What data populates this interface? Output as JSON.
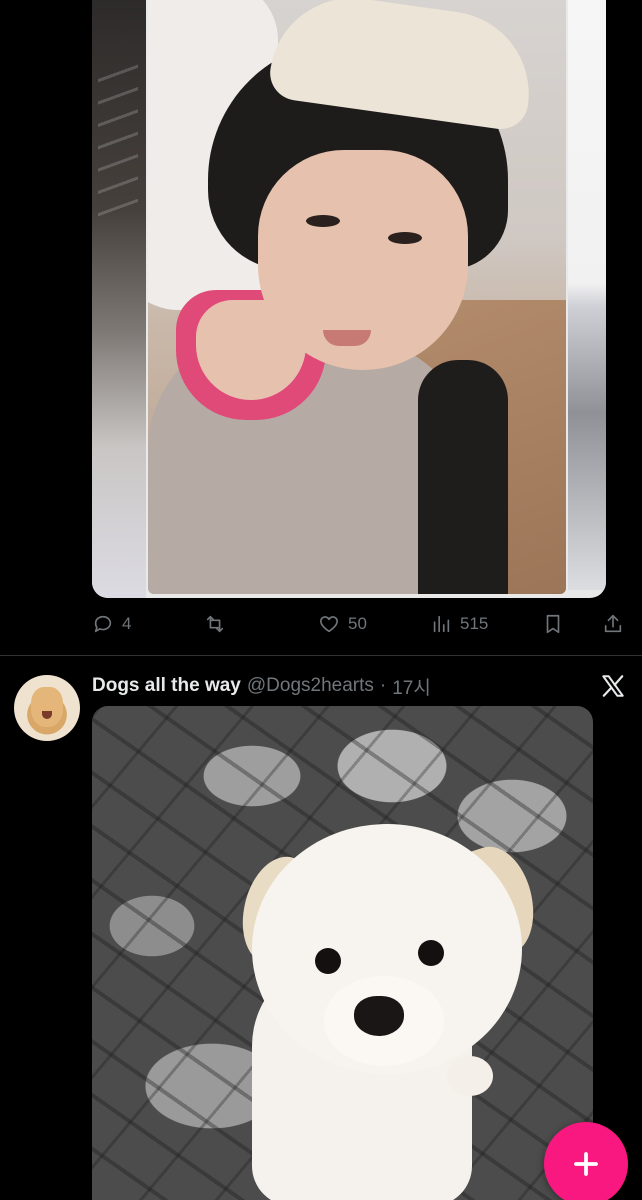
{
  "tweet1": {
    "media_label": "",
    "stats": {
      "replies": "4",
      "retweets": "",
      "likes": "50",
      "views": "515"
    },
    "icons": {
      "reply": "reply-icon",
      "retweet": "retweet-icon",
      "like": "heart-icon",
      "views": "views-icon",
      "bookmark": "bookmark-icon",
      "share": "share-icon"
    }
  },
  "tweet2": {
    "display_name": "Dogs all the way",
    "handle": "@Dogs2hearts",
    "separator": "·",
    "time": "17시",
    "source_icon": "x-logo-icon"
  },
  "fab": {
    "icon": "plus-icon"
  },
  "colors": {
    "background": "#000000",
    "text_primary": "#e7e9ea",
    "text_secondary": "#71767b",
    "accent": "#f91880",
    "divider": "#2f3336"
  }
}
